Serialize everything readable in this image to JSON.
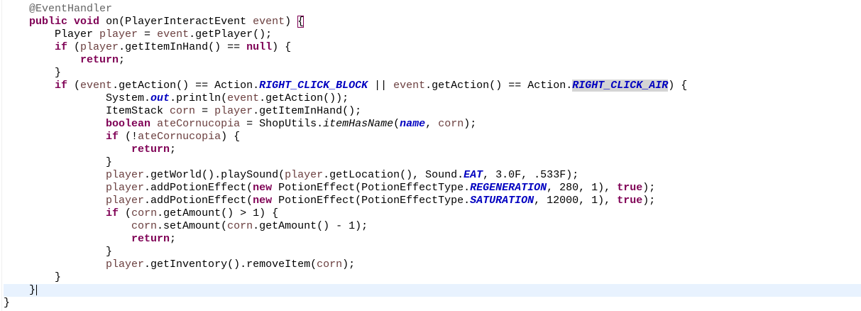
{
  "editor": {
    "current_line": 23,
    "lines": [
      [
        [
          "p",
          "    "
        ],
        [
          "a",
          "@EventHandler"
        ]
      ],
      [
        [
          "p",
          "    "
        ],
        [
          "k",
          "public"
        ],
        [
          "p",
          " "
        ],
        [
          "k",
          "void"
        ],
        [
          "p",
          " on(PlayerInteractEvent "
        ],
        [
          "v",
          "event"
        ],
        [
          "p",
          ") "
        ],
        [
          "br",
          "{"
        ]
      ],
      [
        [
          "p",
          "        Player "
        ],
        [
          "v",
          "player"
        ],
        [
          "p",
          " = "
        ],
        [
          "v",
          "event"
        ],
        [
          "p",
          ".getPlayer();"
        ]
      ],
      [
        [
          "p",
          "        "
        ],
        [
          "k",
          "if"
        ],
        [
          "p",
          " ("
        ],
        [
          "v",
          "player"
        ],
        [
          "p",
          ".getItemInHand() == "
        ],
        [
          "k",
          "null"
        ],
        [
          "p",
          ") {"
        ]
      ],
      [
        [
          "p",
          "            "
        ],
        [
          "k",
          "return"
        ],
        [
          "p",
          ";"
        ]
      ],
      [
        [
          "p",
          "        }"
        ]
      ],
      [
        [
          "p",
          "        "
        ],
        [
          "k",
          "if"
        ],
        [
          "p",
          " ("
        ],
        [
          "v",
          "event"
        ],
        [
          "p",
          ".getAction() == Action."
        ],
        [
          "f",
          "RIGHT_CLICK_BLOCK"
        ],
        [
          "p",
          " || "
        ],
        [
          "v",
          "event"
        ],
        [
          "p",
          ".getAction() == Action."
        ],
        [
          "fsel",
          "RIGHT_CLICK_AIR"
        ],
        [
          "p",
          ") {"
        ]
      ],
      [
        [
          "p",
          "                System."
        ],
        [
          "f",
          "out"
        ],
        [
          "p",
          ".println("
        ],
        [
          "v",
          "event"
        ],
        [
          "p",
          ".getAction());"
        ]
      ],
      [
        [
          "p",
          "                ItemStack "
        ],
        [
          "v",
          "corn"
        ],
        [
          "p",
          " = "
        ],
        [
          "v",
          "player"
        ],
        [
          "p",
          ".getItemInHand();"
        ]
      ],
      [
        [
          "p",
          "                "
        ],
        [
          "k",
          "boolean"
        ],
        [
          "p",
          " "
        ],
        [
          "v",
          "ateCornucopia"
        ],
        [
          "p",
          " = ShopUtils."
        ],
        [
          "sm",
          "itemHasName"
        ],
        [
          "p",
          "("
        ],
        [
          "f",
          "name"
        ],
        [
          "p",
          ", "
        ],
        [
          "v",
          "corn"
        ],
        [
          "p",
          ");"
        ]
      ],
      [
        [
          "p",
          "                "
        ],
        [
          "k",
          "if"
        ],
        [
          "p",
          " (!"
        ],
        [
          "v",
          "ateCornucopia"
        ],
        [
          "p",
          ") {"
        ]
      ],
      [
        [
          "p",
          "                    "
        ],
        [
          "k",
          "return"
        ],
        [
          "p",
          ";"
        ]
      ],
      [
        [
          "p",
          "                }"
        ]
      ],
      [
        [
          "p",
          "                "
        ],
        [
          "v",
          "player"
        ],
        [
          "p",
          ".getWorld().playSound("
        ],
        [
          "v",
          "player"
        ],
        [
          "p",
          ".getLocation(), Sound."
        ],
        [
          "f",
          "EAT"
        ],
        [
          "p",
          ", 3.0F, .533F);"
        ]
      ],
      [
        [
          "p",
          "                "
        ],
        [
          "v",
          "player"
        ],
        [
          "p",
          ".addPotionEffect("
        ],
        [
          "k",
          "new"
        ],
        [
          "p",
          " PotionEffect(PotionEffectType."
        ],
        [
          "f",
          "REGENERATION"
        ],
        [
          "p",
          ", 280, 1), "
        ],
        [
          "k",
          "true"
        ],
        [
          "p",
          ");"
        ]
      ],
      [
        [
          "p",
          "                "
        ],
        [
          "v",
          "player"
        ],
        [
          "p",
          ".addPotionEffect("
        ],
        [
          "k",
          "new"
        ],
        [
          "p",
          " PotionEffect(PotionEffectType."
        ],
        [
          "f",
          "SATURATION"
        ],
        [
          "p",
          ", 12000, 1), "
        ],
        [
          "k",
          "true"
        ],
        [
          "p",
          ");"
        ]
      ],
      [
        [
          "p",
          "                "
        ],
        [
          "k",
          "if"
        ],
        [
          "p",
          " ("
        ],
        [
          "v",
          "corn"
        ],
        [
          "p",
          ".getAmount() > 1) {"
        ]
      ],
      [
        [
          "p",
          "                    "
        ],
        [
          "v",
          "corn"
        ],
        [
          "p",
          ".setAmount("
        ],
        [
          "v",
          "corn"
        ],
        [
          "p",
          ".getAmount() - 1);"
        ]
      ],
      [
        [
          "p",
          "                    "
        ],
        [
          "k",
          "return"
        ],
        [
          "p",
          ";"
        ]
      ],
      [
        [
          "p",
          "                }"
        ]
      ],
      [
        [
          "p",
          "                "
        ],
        [
          "v",
          "player"
        ],
        [
          "p",
          ".getInventory().removeItem("
        ],
        [
          "v",
          "corn"
        ],
        [
          "p",
          ");"
        ]
      ],
      [
        [
          "p",
          "        }"
        ]
      ],
      [
        [
          "p",
          "    }"
        ]
      ],
      [
        [
          "p",
          "}"
        ]
      ]
    ]
  }
}
